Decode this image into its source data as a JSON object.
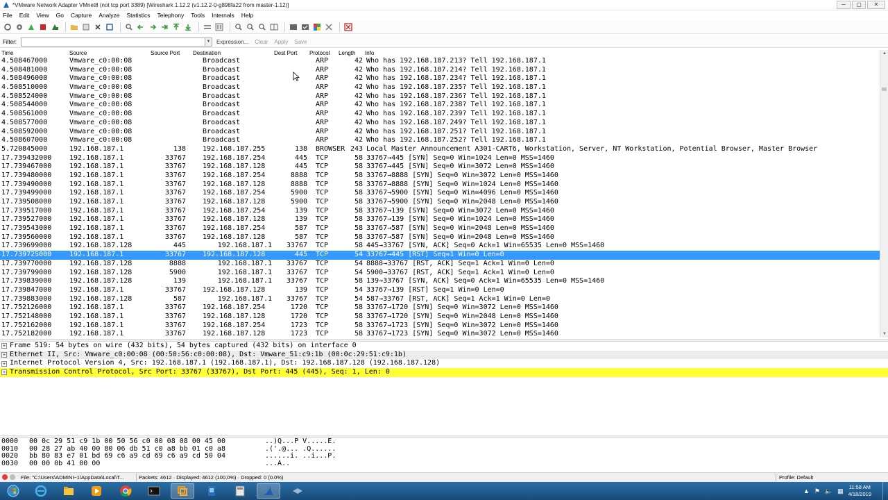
{
  "window": {
    "title": "*VMware Network Adapter VMnet8 (not tcp port 3389)   [Wireshark 1.12.2  (v1.12.2-0-g898fa22 from master-1.12)]",
    "minimize": "─",
    "maximize": "▢",
    "close": "✕"
  },
  "menu": [
    "File",
    "Edit",
    "View",
    "Go",
    "Capture",
    "Analyze",
    "Statistics",
    "Telephony",
    "Tools",
    "Internals",
    "Help"
  ],
  "filter": {
    "label": "Filter:",
    "value": "",
    "expression": "Expression...",
    "clear": "Clear",
    "apply": "Apply",
    "save": "Save"
  },
  "columns": [
    "Time",
    "Source",
    "Source Port",
    "Destination",
    "Dest Port",
    "Protocol",
    "Length",
    "Info"
  ],
  "packets": [
    {
      "time": "4.508467000",
      "src": "Vmware_c0:00:08",
      "sport": "",
      "dst": "Broadcast",
      "dport": "",
      "proto": "ARP",
      "len": "42",
      "info": "Who has 192.168.187.213?  Tell 192.168.187.1"
    },
    {
      "time": "4.508481000",
      "src": "Vmware_c0:00:08",
      "sport": "",
      "dst": "Broadcast",
      "dport": "",
      "proto": "ARP",
      "len": "42",
      "info": "Who has 192.168.187.214?  Tell 192.168.187.1"
    },
    {
      "time": "4.508496000",
      "src": "Vmware_c0:00:08",
      "sport": "",
      "dst": "Broadcast",
      "dport": "",
      "proto": "ARP",
      "len": "42",
      "info": "Who has 192.168.187.234?  Tell 192.168.187.1"
    },
    {
      "time": "4.508510000",
      "src": "Vmware_c0:00:08",
      "sport": "",
      "dst": "Broadcast",
      "dport": "",
      "proto": "ARP",
      "len": "42",
      "info": "Who has 192.168.187.235?  Tell 192.168.187.1"
    },
    {
      "time": "4.508524000",
      "src": "Vmware_c0:00:08",
      "sport": "",
      "dst": "Broadcast",
      "dport": "",
      "proto": "ARP",
      "len": "42",
      "info": "Who has 192.168.187.236?  Tell 192.168.187.1"
    },
    {
      "time": "4.508544000",
      "src": "Vmware_c0:00:08",
      "sport": "",
      "dst": "Broadcast",
      "dport": "",
      "proto": "ARP",
      "len": "42",
      "info": "Who has 192.168.187.238?  Tell 192.168.187.1"
    },
    {
      "time": "4.508561000",
      "src": "Vmware_c0:00:08",
      "sport": "",
      "dst": "Broadcast",
      "dport": "",
      "proto": "ARP",
      "len": "42",
      "info": "Who has 192.168.187.239?  Tell 192.168.187.1"
    },
    {
      "time": "4.508577000",
      "src": "Vmware_c0:00:08",
      "sport": "",
      "dst": "Broadcast",
      "dport": "",
      "proto": "ARP",
      "len": "42",
      "info": "Who has 192.168.187.249?  Tell 192.168.187.1"
    },
    {
      "time": "4.508592000",
      "src": "Vmware_c0:00:08",
      "sport": "",
      "dst": "Broadcast",
      "dport": "",
      "proto": "ARP",
      "len": "42",
      "info": "Who has 192.168.187.251?  Tell 192.168.187.1"
    },
    {
      "time": "4.508607000",
      "src": "Vmware_c0:00:08",
      "sport": "",
      "dst": "Broadcast",
      "dport": "",
      "proto": "ARP",
      "len": "42",
      "info": "Who has 192.168.187.252?  Tell 192.168.187.1"
    },
    {
      "time": "5.720845000",
      "src": "192.168.187.1",
      "sport": "138",
      "dst": "192.168.187.255",
      "dport": "138",
      "proto": "BROWSER",
      "len": "243",
      "info": "Local Master Announcement A301-CART6, Workstation, Server, NT Workstation, Potential Browser, Master Browser"
    },
    {
      "time": "17.739432000",
      "src": "192.168.187.1",
      "sport": "33767",
      "dst": "192.168.187.254",
      "dport": "445",
      "proto": "TCP",
      "len": "58",
      "info": "33767→445 [SYN] Seq=0 Win=1024 Len=0 MSS=1460"
    },
    {
      "time": "17.739467000",
      "src": "192.168.187.1",
      "sport": "33767",
      "dst": "192.168.187.128",
      "dport": "445",
      "proto": "TCP",
      "len": "58",
      "info": "33767→445 [SYN] Seq=0 Win=3072 Len=0 MSS=1460"
    },
    {
      "time": "17.739480000",
      "src": "192.168.187.1",
      "sport": "33767",
      "dst": "192.168.187.254",
      "dport": "8888",
      "proto": "TCP",
      "len": "58",
      "info": "33767→8888 [SYN] Seq=0 Win=3072 Len=0 MSS=1460"
    },
    {
      "time": "17.739490000",
      "src": "192.168.187.1",
      "sport": "33767",
      "dst": "192.168.187.128",
      "dport": "8888",
      "proto": "TCP",
      "len": "58",
      "info": "33767→8888 [SYN] Seq=0 Win=1024 Len=0 MSS=1460"
    },
    {
      "time": "17.739499000",
      "src": "192.168.187.1",
      "sport": "33767",
      "dst": "192.168.187.254",
      "dport": "5900",
      "proto": "TCP",
      "len": "58",
      "info": "33767→5900 [SYN] Seq=0 Win=4096 Len=0 MSS=1460"
    },
    {
      "time": "17.739508000",
      "src": "192.168.187.1",
      "sport": "33767",
      "dst": "192.168.187.128",
      "dport": "5900",
      "proto": "TCP",
      "len": "58",
      "info": "33767→5900 [SYN] Seq=0 Win=2048 Len=0 MSS=1460"
    },
    {
      "time": "17.739517000",
      "src": "192.168.187.1",
      "sport": "33767",
      "dst": "192.168.187.254",
      "dport": "139",
      "proto": "TCP",
      "len": "58",
      "info": "33767→139 [SYN] Seq=0 Win=3072 Len=0 MSS=1460"
    },
    {
      "time": "17.739527000",
      "src": "192.168.187.1",
      "sport": "33767",
      "dst": "192.168.187.128",
      "dport": "139",
      "proto": "TCP",
      "len": "58",
      "info": "33767→139 [SYN] Seq=0 Win=1024 Len=0 MSS=1460"
    },
    {
      "time": "17.739543000",
      "src": "192.168.187.1",
      "sport": "33767",
      "dst": "192.168.187.254",
      "dport": "587",
      "proto": "TCP",
      "len": "58",
      "info": "33767→587 [SYN] Seq=0 Win=2048 Len=0 MSS=1460"
    },
    {
      "time": "17.739560000",
      "src": "192.168.187.1",
      "sport": "33767",
      "dst": "192.168.187.128",
      "dport": "587",
      "proto": "TCP",
      "len": "58",
      "info": "33767→587 [SYN] Seq=0 Win=2048 Len=0 MSS=1460"
    },
    {
      "time": "17.739699000",
      "src": "192.168.187.128",
      "sport": "445",
      "dst": "192.168.187.1",
      "dport": "33767",
      "proto": "TCP",
      "len": "58",
      "info": "445→33767 [SYN, ACK] Seq=0 Ack=1 Win=65535 Len=0 MSS=1460"
    },
    {
      "time": "17.739725000",
      "src": "192.168.187.1",
      "sport": "33767",
      "dst": "192.168.187.128",
      "dport": "445",
      "proto": "TCP",
      "len": "54",
      "info": "33767→445 [RST] Seq=1 Win=0 Len=0",
      "selected": true
    },
    {
      "time": "17.739770000",
      "src": "192.168.187.128",
      "sport": "8888",
      "dst": "192.168.187.1",
      "dport": "33767",
      "proto": "TCP",
      "len": "54",
      "info": "8888→33767 [RST, ACK] Seq=1 Ack=1 Win=0 Len=0"
    },
    {
      "time": "17.739799000",
      "src": "192.168.187.128",
      "sport": "5900",
      "dst": "192.168.187.1",
      "dport": "33767",
      "proto": "TCP",
      "len": "54",
      "info": "5900→33767 [RST, ACK] Seq=1 Ack=1 Win=0 Len=0"
    },
    {
      "time": "17.739839000",
      "src": "192.168.187.128",
      "sport": "139",
      "dst": "192.168.187.1",
      "dport": "33767",
      "proto": "TCP",
      "len": "58",
      "info": "139→33767 [SYN, ACK] Seq=0 Ack=1 Win=65535 Len=0 MSS=1460"
    },
    {
      "time": "17.739847000",
      "src": "192.168.187.1",
      "sport": "33767",
      "dst": "192.168.187.128",
      "dport": "139",
      "proto": "TCP",
      "len": "54",
      "info": "33767→139 [RST] Seq=1 Win=0 Len=0"
    },
    {
      "time": "17.739883000",
      "src": "192.168.187.128",
      "sport": "587",
      "dst": "192.168.187.1",
      "dport": "33767",
      "proto": "TCP",
      "len": "54",
      "info": "587→33767 [RST, ACK] Seq=1 Ack=1 Win=0 Len=0"
    },
    {
      "time": "17.752126000",
      "src": "192.168.187.1",
      "sport": "33767",
      "dst": "192.168.187.254",
      "dport": "1720",
      "proto": "TCP",
      "len": "58",
      "info": "33767→1720 [SYN] Seq=0 Win=3072 Len=0 MSS=1460"
    },
    {
      "time": "17.752148000",
      "src": "192.168.187.1",
      "sport": "33767",
      "dst": "192.168.187.128",
      "dport": "1720",
      "proto": "TCP",
      "len": "58",
      "info": "33767→1720 [SYN] Seq=0 Win=2048 Len=0 MSS=1460"
    },
    {
      "time": "17.752162000",
      "src": "192.168.187.1",
      "sport": "33767",
      "dst": "192.168.187.254",
      "dport": "1723",
      "proto": "TCP",
      "len": "58",
      "info": "33767→1723 [SYN] Seq=0 Win=3072 Len=0 MSS=1460"
    },
    {
      "time": "17.752182000",
      "src": "192.168.187.1",
      "sport": "33767",
      "dst": "192.168.187.128",
      "dport": "1723",
      "proto": "TCP",
      "len": "58",
      "info": "33767→1723 [SYN] Seq=0 Win=3072 Len=0 MSS=1460"
    }
  ],
  "details": [
    "Frame 519: 54 bytes on wire (432 bits), 54 bytes captured (432 bits) on interface 0",
    "Ethernet II, Src: Vmware_c0:00:08 (00:50:56:c0:00:08), Dst: Vmware_51:c9:1b (00:0c:29:51:c9:1b)",
    "Internet Protocol Version 4, Src: 192.168.187.1 (192.168.187.1), Dst: 192.168.187.128 (192.168.187.128)",
    "Transmission Control Protocol, Src Port: 33767 (33767), Dst Port: 445 (445), Seq: 1, Len: 0"
  ],
  "expand_symbol": "+",
  "bytes": [
    {
      "offset": "0000",
      "hex": "00 0c 29 51 c9 1b 00 50  56 c0 00 08 08 00 45 00",
      "ascii": "..)Q...P V.....E."
    },
    {
      "offset": "0010",
      "hex": "00 28 27 ab 40 00 80 06  db 51 c0 a8 bb 01 c0 a8",
      "ascii": ".('.@... .Q......"
    },
    {
      "offset": "0020",
      "hex": "bb 80 83 e7 01 bd 69 c6  a9 cd 69 c6 a9 cd 50 04",
      "ascii": "......i. ..i...P."
    },
    {
      "offset": "0030",
      "hex": "00 00 0b 41 00 00",
      "ascii": "...A.."
    }
  ],
  "status": {
    "file": "File: \"C:\\Users\\ADMINI~1\\AppData\\Local\\T...",
    "packets": "Packets: 4612 · Displayed: 4612 (100.0%) · Dropped: 0 (0.0%)",
    "profile": "Profile: Default"
  },
  "clock": {
    "time": "11:58 AM",
    "date": "4/18/2019"
  },
  "colors": {
    "selected_row": "#3399ff",
    "highlight_detail": "#ffff33",
    "taskbar": "#1d5a8c"
  }
}
